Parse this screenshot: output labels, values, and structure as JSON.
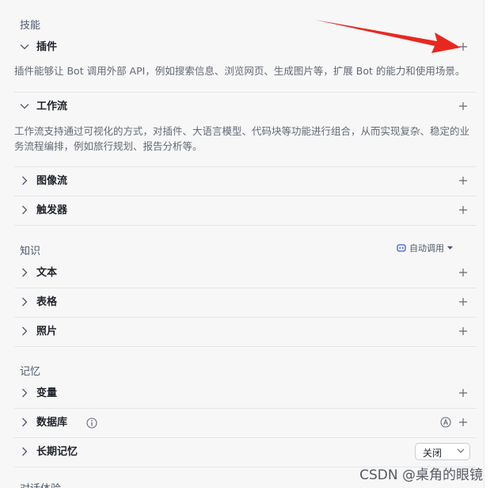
{
  "skills": {
    "title": "技能",
    "plugins": {
      "label": "插件",
      "description": "插件能够让 Bot 调用外部 API，例如搜索信息、浏览网页、生成图片等，扩展 Bot 的能力和使用场景。"
    },
    "workflow": {
      "label": "工作流",
      "description": "工作流支持通过可视化的方式，对插件、大语言模型、代码块等功能进行组合，从而实现复杂、稳定的业务流程编排，例如旅行规划、报告分析等。"
    },
    "imageflow": {
      "label": "图像流"
    },
    "trigger": {
      "label": "触发器"
    }
  },
  "knowledge": {
    "title": "知识",
    "auto_call_label": "自动调用",
    "text": {
      "label": "文本"
    },
    "table": {
      "label": "表格"
    },
    "photo": {
      "label": "照片"
    }
  },
  "memory": {
    "title": "记忆",
    "variable": {
      "label": "变量"
    },
    "database": {
      "label": "数据库"
    },
    "long_term": {
      "label": "长期记忆",
      "select_value": "关闭"
    }
  },
  "next_section_title": "对话体验",
  "watermark": "CSDN @桌角的眼镜",
  "colors": {
    "arrow": "#e8281f",
    "accent": "#3b5bdb"
  }
}
